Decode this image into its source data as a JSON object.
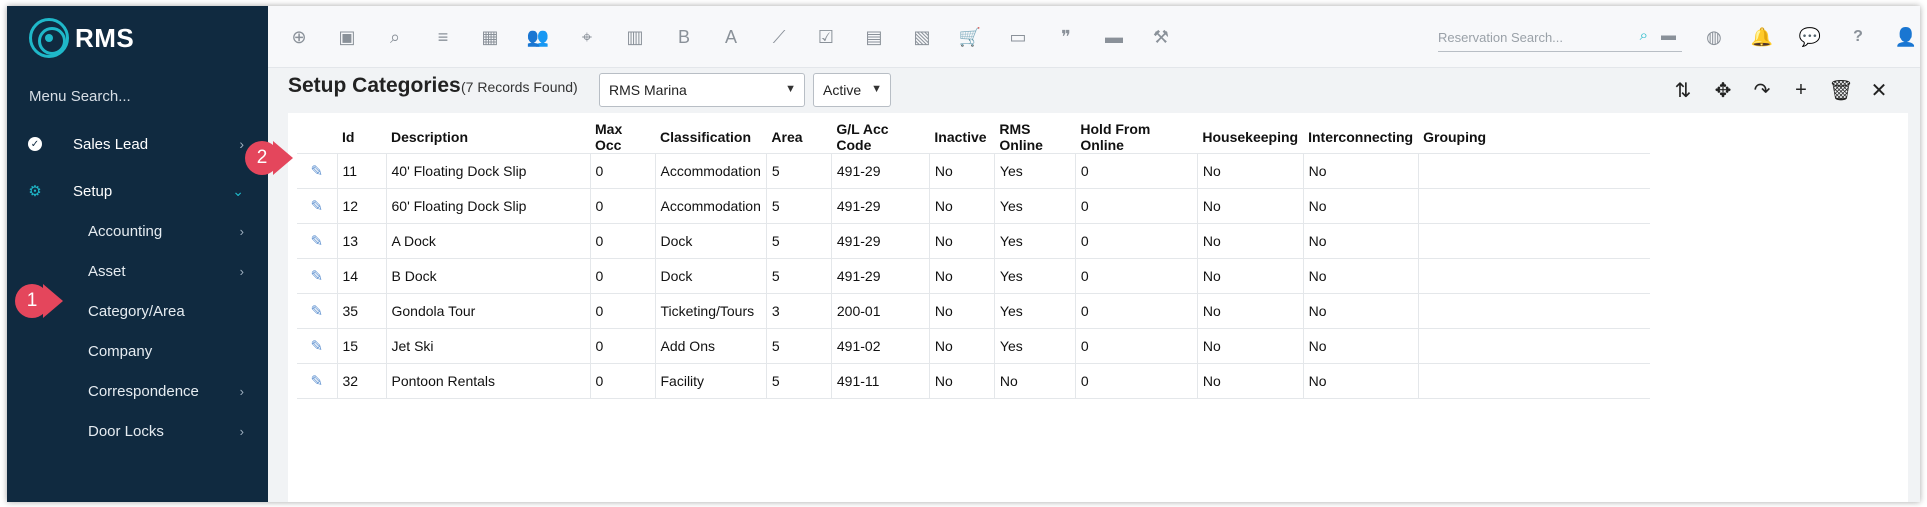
{
  "brand": {
    "name": "RMS",
    "accent": "#1fb8c9",
    "sidebar_bg": "#102a40"
  },
  "sidebar": {
    "search_placeholder": "Menu Search...",
    "items": [
      {
        "label": "Sales Lead",
        "icon": "check-circle-icon",
        "chevron": "›"
      },
      {
        "label": "Setup",
        "icon": "gear-icon",
        "chevron": "⌄"
      }
    ],
    "sub_items": [
      {
        "label": "Accounting",
        "chevron": "›"
      },
      {
        "label": "Asset",
        "chevron": "›"
      },
      {
        "label": "Category/Area",
        "chevron": ""
      },
      {
        "label": "Company",
        "chevron": ""
      },
      {
        "label": "Correspondence",
        "chevron": "›"
      },
      {
        "label": "Door Locks",
        "chevron": "›"
      }
    ]
  },
  "toolbar": {
    "icons": [
      "add-circle-icon",
      "calendar-icon",
      "search-icon",
      "sliders-icon",
      "grid-icon",
      "users-icon",
      "map-pin-icon",
      "map-icon",
      "bold-icon",
      "font-icon",
      "line-chart-icon",
      "checklist-icon",
      "id-card-icon",
      "report-icon",
      "cart-icon",
      "payment-icon",
      "quote-icon",
      "bed-icon",
      "hammer-icon"
    ],
    "glyphs": [
      "⊕",
      "▣",
      "⌕",
      "≡",
      "▦",
      "👥",
      "⌖",
      "▥",
      "B",
      "A",
      "⟋",
      "☑",
      "▤",
      "▧",
      "🛒",
      "▭",
      "❞",
      "▬",
      "⚒"
    ],
    "reservation_search_placeholder": "Reservation Search...",
    "right_icons": [
      "globe-icon",
      "bell-icon",
      "chat-icon",
      "help-icon",
      "user-icon"
    ],
    "right_glyphs": [
      "◍",
      "🔔",
      "💬",
      "?",
      "👤"
    ]
  },
  "main": {
    "title": "Setup Categories",
    "records_found": "(7 Records Found)",
    "property_select": "RMS Marina",
    "status_select": "Active",
    "actions": [
      "sort-icon",
      "move-icon",
      "redo-icon",
      "add-icon",
      "trash-icon",
      "close-icon"
    ],
    "action_glyphs": [
      "⇅",
      "✥",
      "↷",
      "+",
      "🗑",
      "✕"
    ]
  },
  "table": {
    "columns": [
      "",
      "Id",
      "Description",
      "Max Occ",
      "Classification",
      "Area",
      "G/L Acc Code",
      "Inactive",
      "RMS Online",
      "Hold From Online",
      "Housekeeping",
      "Interconnecting",
      "Grouping"
    ],
    "rows": [
      [
        "11",
        "40' Floating Dock Slip",
        "0",
        "Accommodation",
        "5",
        "491-29",
        "No",
        "Yes",
        "0",
        "No",
        "No",
        ""
      ],
      [
        "12",
        "60' Floating Dock Slip",
        "0",
        "Accommodation",
        "5",
        "491-29",
        "No",
        "Yes",
        "0",
        "No",
        "No",
        ""
      ],
      [
        "13",
        "A Dock",
        "0",
        "Dock",
        "5",
        "491-29",
        "No",
        "Yes",
        "0",
        "No",
        "No",
        ""
      ],
      [
        "14",
        "B Dock",
        "0",
        "Dock",
        "5",
        "491-29",
        "No",
        "Yes",
        "0",
        "No",
        "No",
        ""
      ],
      [
        "35",
        "Gondola Tour",
        "0",
        "Ticketing/Tours",
        "3",
        "200-01",
        "No",
        "Yes",
        "0",
        "No",
        "No",
        ""
      ],
      [
        "15",
        "Jet Ski",
        "0",
        "Add Ons",
        "5",
        "491-02",
        "No",
        "Yes",
        "0",
        "No",
        "No",
        ""
      ],
      [
        "32",
        "Pontoon Rentals",
        "0",
        "Facility",
        "5",
        "491-11",
        "No",
        "No",
        "0",
        "No",
        "No",
        ""
      ]
    ]
  },
  "callouts": [
    {
      "number": "1"
    },
    {
      "number": "2"
    }
  ]
}
